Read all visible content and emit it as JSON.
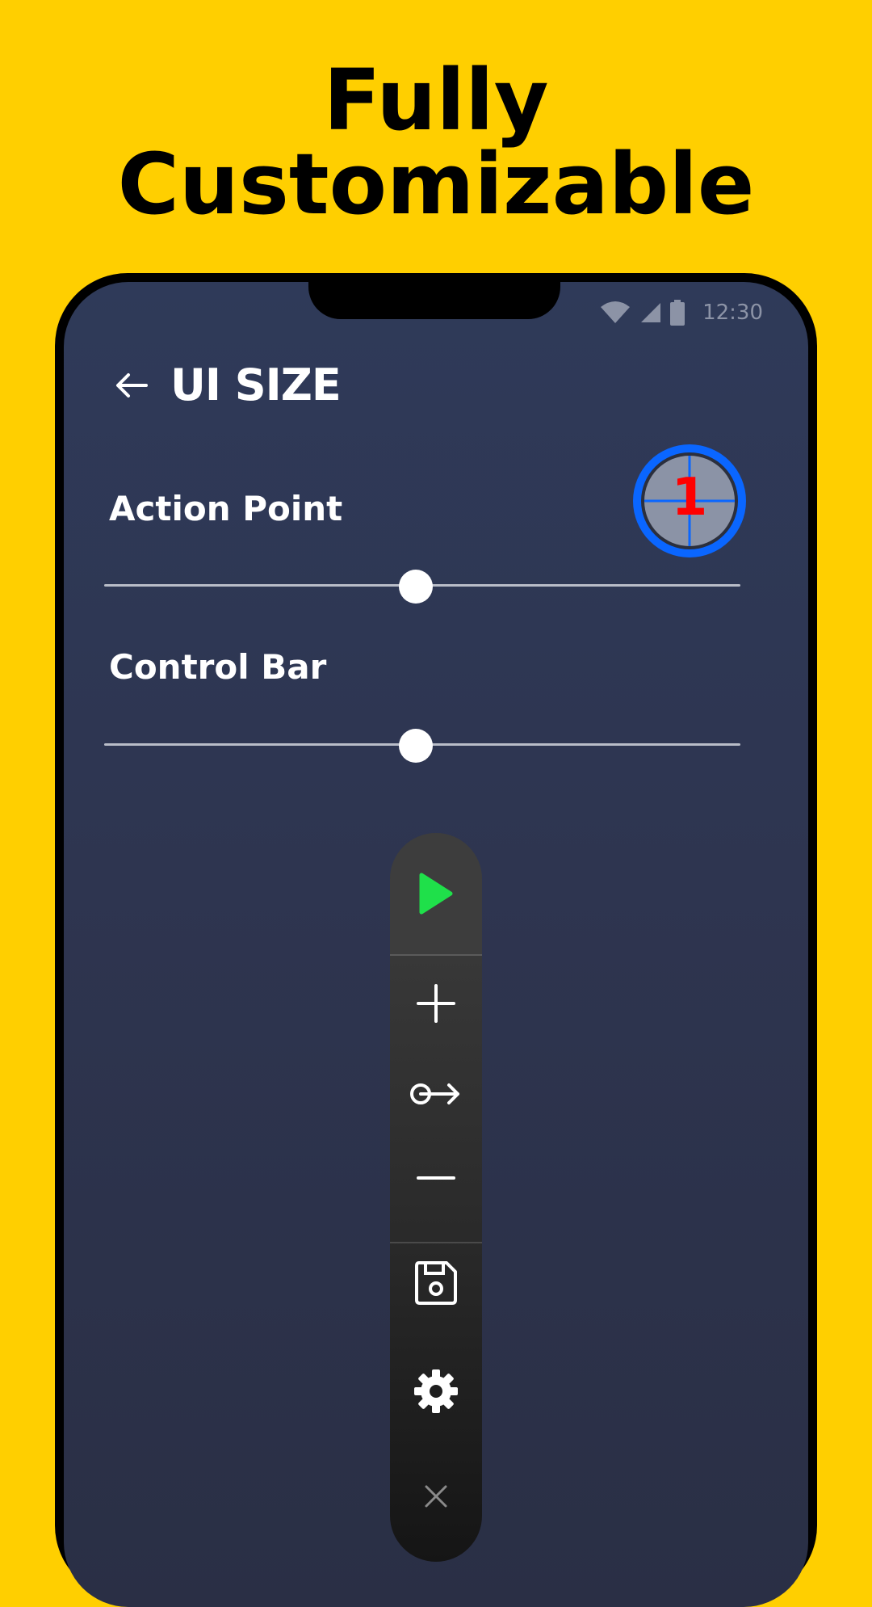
{
  "headline": {
    "line1": "Fully",
    "line2": "Customizable"
  },
  "status_bar": {
    "time": "12:30",
    "icons": [
      "wifi-icon",
      "signal-icon",
      "battery-icon"
    ]
  },
  "screen": {
    "title": "UI SIZE",
    "back_icon": "arrow-left-icon"
  },
  "settings": {
    "action_point": {
      "label": "Action Point",
      "value_fraction": 0.49,
      "preview_number": "1"
    },
    "control_bar": {
      "label": "Control Bar",
      "value_fraction": 0.49
    }
  },
  "control_bar": {
    "buttons": [
      "play-icon",
      "plus-icon",
      "swipe-arrow-icon",
      "minus-icon",
      "save-icon",
      "gear-icon",
      "close-icon"
    ]
  },
  "colors": {
    "background": "#FFCF00",
    "screen": "#2E3550",
    "play": "#1FE04A",
    "target_ring": "#0A66FF",
    "target_number": "#FF0000"
  }
}
